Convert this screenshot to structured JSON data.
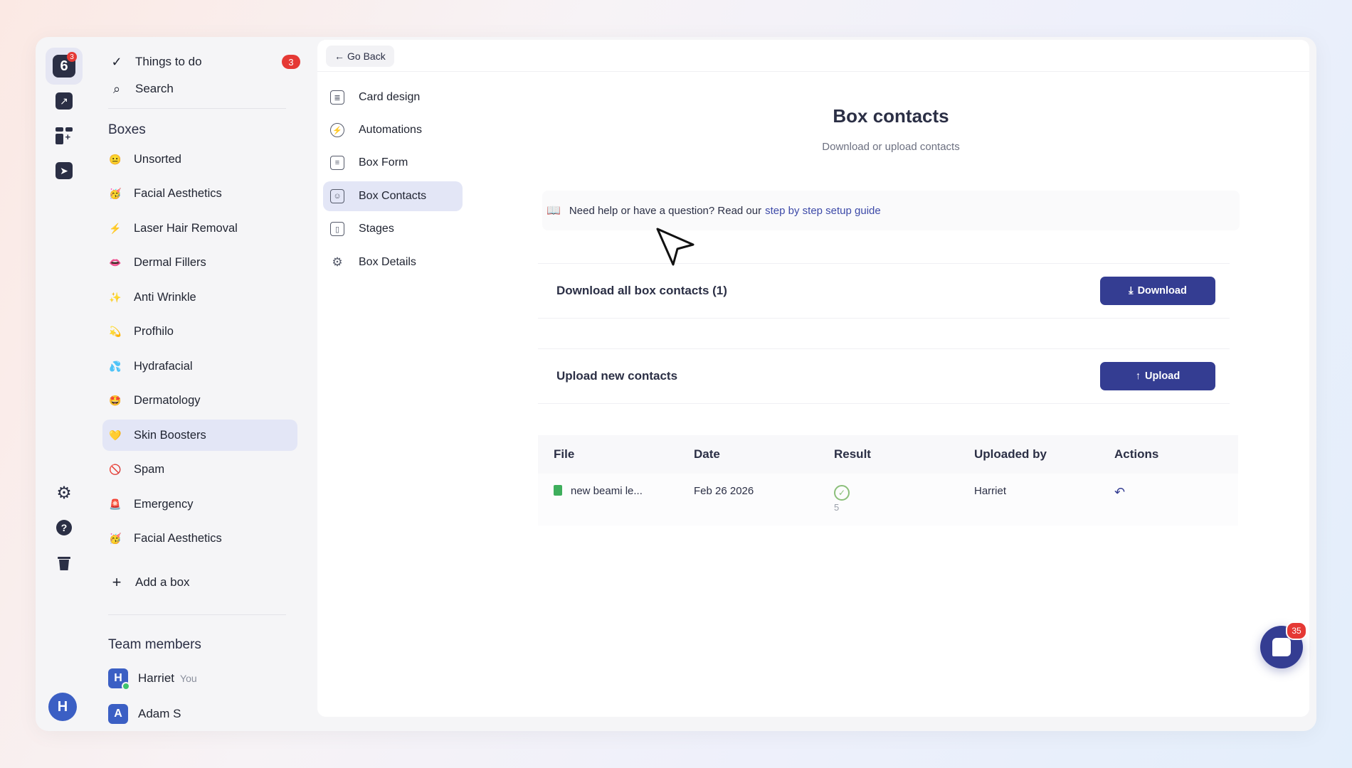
{
  "rail": {
    "logo_badge": "3",
    "avatar_letter": "H"
  },
  "sidebar": {
    "todo_label": "Things to do",
    "todo_badge": "3",
    "search_label": "Search",
    "boxes_title": "Boxes",
    "boxes": [
      {
        "label": "Unsorted",
        "emoji": "😐"
      },
      {
        "label": "Facial Aesthetics",
        "emoji": "🥳"
      },
      {
        "label": "Laser Hair Removal",
        "emoji": "⚡"
      },
      {
        "label": "Dermal Fillers",
        "emoji": "👄"
      },
      {
        "label": "Anti Wrinkle",
        "emoji": "✨"
      },
      {
        "label": "Profhilo",
        "emoji": "💫"
      },
      {
        "label": "Hydrafacial",
        "emoji": "💦"
      },
      {
        "label": "Dermatology",
        "emoji": "🤩"
      },
      {
        "label": "Skin Boosters",
        "emoji": "💛"
      },
      {
        "label": "Spam",
        "emoji": "🚫"
      },
      {
        "label": "Emergency",
        "emoji": "🚨"
      },
      {
        "label": "Facial Aesthetics",
        "emoji": "🥳"
      }
    ],
    "add_box_label": "Add a box",
    "team_title": "Team members",
    "members": [
      {
        "initial": "H",
        "name": "Harriet",
        "tag": "You"
      },
      {
        "initial": "A",
        "name": "Adam S",
        "tag": ""
      }
    ]
  },
  "main": {
    "go_back": "Go Back",
    "subnav": [
      {
        "label": "Card design"
      },
      {
        "label": "Automations"
      },
      {
        "label": "Box Form"
      },
      {
        "label": "Box Contacts"
      },
      {
        "label": "Stages"
      },
      {
        "label": "Box Details"
      }
    ],
    "title": "Box contacts",
    "subtitle": "Download or upload contacts",
    "help_text": "Need help or have a question? Read our",
    "help_link": "step by step setup guide",
    "download_label": "Download all box contacts (1)",
    "download_button": "Download",
    "upload_label": "Upload new contacts",
    "upload_button": "Upload",
    "table": {
      "headers": [
        "File",
        "Date",
        "Result",
        "Uploaded by",
        "Actions"
      ],
      "rows": [
        {
          "file": "new beami le...",
          "date": "Feb 26 2026",
          "result_count": "5",
          "uploaded_by": "Harriet"
        }
      ]
    }
  },
  "chat": {
    "badge": "35"
  },
  "colors": {
    "primary": "#343d92",
    "badge": "#e53935",
    "active_bg": "#e3e6f6"
  }
}
